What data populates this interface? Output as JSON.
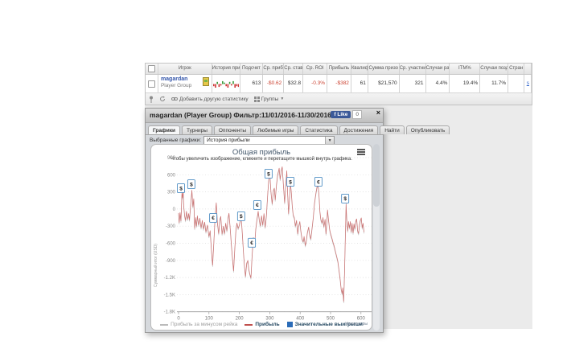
{
  "page": {
    "bg": "#ffffff",
    "content_bg": "#ebebeb"
  },
  "table": {
    "headers": [
      "",
      "Игрок",
      "История прибы",
      "Подсчет",
      "Ср. прибы",
      "Ср. ставк",
      "Ср. ROI",
      "Прибыль",
      "Квалиф",
      "Сумма призо",
      "Ср. участни",
      "Случаи ран",
      "ITM%",
      "Случаи позд",
      "Стран",
      ""
    ],
    "row": {
      "player": "magardan",
      "player_sub": "Player Group",
      "sparkline": [
        -3,
        -5,
        3,
        -4,
        -2,
        4,
        2,
        -3,
        -5,
        3,
        -2,
        4,
        -5,
        -3,
        -4
      ],
      "values": [
        {
          "v": "613"
        },
        {
          "v": "-$0.62",
          "neg": true
        },
        {
          "v": "$32.8"
        },
        {
          "v": "-0.3%",
          "neg": true
        },
        {
          "v": "-$382",
          "neg": true
        },
        {
          "v": "61"
        },
        {
          "v": "$21,570"
        },
        {
          "v": "321"
        },
        {
          "v": "4.4%"
        },
        {
          "v": "19.4%"
        },
        {
          "v": "11.7%"
        },
        {
          "v": ""
        },
        {
          "v": "s",
          "link": true
        }
      ]
    },
    "footer": {
      "add_stat": "Добавить другую статистику",
      "groups": "Группы"
    }
  },
  "widget": {
    "title": "magardan (Player Group) Фильтр:11/01/2016-11/30/2016",
    "fb": {
      "like": "Like",
      "count": "0",
      "logo": "f"
    },
    "close": "×",
    "tabs": [
      {
        "label": "Графики",
        "active": true
      },
      {
        "label": "Турниры",
        "active": false
      },
      {
        "label": "Оппоненты",
        "active": false
      },
      {
        "label": "Любимые игры",
        "active": false
      },
      {
        "label": "Статистика",
        "active": false
      },
      {
        "label": "Достижения",
        "active": false
      },
      {
        "label": "Найти",
        "active": false
      },
      {
        "label": "Опубликовать",
        "active": false
      }
    ],
    "selector_label": "Выбранные графики:",
    "selector_value": "История прибыли"
  },
  "chart_data": {
    "type": "line",
    "title": "Общая прибыль",
    "subtitle": "Чтобы увеличить изображение, кликните и перетащите мышкой внутрь графика.",
    "xlabel": "Номер игры",
    "ylabel": "Суммарный итог (USD)",
    "xlim": [
      0,
      620
    ],
    "ylim": [
      -1800,
      900
    ],
    "grid": "horizontal-dotted",
    "legend_position": "bottom",
    "yticks": [
      {
        "v": 900,
        "label": "900"
      },
      {
        "v": 600,
        "label": "600"
      },
      {
        "v": 300,
        "label": "300"
      },
      {
        "v": 0,
        "label": "0"
      },
      {
        "v": -300,
        "label": "-300"
      },
      {
        "v": -600,
        "label": "-600"
      },
      {
        "v": -900,
        "label": "-900"
      },
      {
        "v": -1200,
        "label": "-1.2K"
      },
      {
        "v": -1500,
        "label": "-1.5K"
      },
      {
        "v": -1800,
        "label": "-1.8K"
      }
    ],
    "xticks": [
      0,
      100,
      200,
      300,
      400,
      500,
      600
    ],
    "colors": {
      "profit_line": "#cc7070",
      "rake_line": "#c9c9c9",
      "marker_border": "#4f8fc4",
      "big_win_square": "#2b6cb8",
      "legend_red": "#c0504d",
      "grid": "#dcdcdc"
    },
    "legend": [
      "Прибыль за минусом рейка",
      "Прибыль",
      "Значительные выигрыши"
    ],
    "series": [
      {
        "name": "Прибыль за минусом рейка",
        "offset_from_profit": -25
      },
      {
        "name": "Прибыль",
        "points": [
          [
            0,
            -70
          ],
          [
            2,
            -240
          ],
          [
            5,
            -60
          ],
          [
            8,
            -210
          ],
          [
            11,
            280
          ],
          [
            13,
            200
          ],
          [
            15,
            320
          ],
          [
            17,
            60
          ],
          [
            20,
            -120
          ],
          [
            23,
            -200
          ],
          [
            26,
            -40
          ],
          [
            30,
            -180
          ],
          [
            33,
            -80
          ],
          [
            36,
            -190
          ],
          [
            40,
            90
          ],
          [
            44,
            330
          ],
          [
            47,
            40
          ],
          [
            50,
            180
          ],
          [
            53,
            -340
          ],
          [
            56,
            -150
          ],
          [
            59,
            -300
          ],
          [
            62,
            -120
          ],
          [
            66,
            -280
          ],
          [
            70,
            -160
          ],
          [
            74,
            -330
          ],
          [
            78,
            -200
          ],
          [
            82,
            -350
          ],
          [
            86,
            -230
          ],
          [
            90,
            -400
          ],
          [
            95,
            -280
          ],
          [
            100,
            -480
          ],
          [
            104,
            -380
          ],
          [
            108,
            -700
          ],
          [
            112,
            -985
          ],
          [
            116,
            -600
          ],
          [
            120,
            -150
          ],
          [
            124,
            110
          ],
          [
            128,
            -250
          ],
          [
            132,
            -430
          ],
          [
            136,
            -180
          ],
          [
            139,
            -130
          ],
          [
            143,
            -440
          ],
          [
            147,
            -300
          ],
          [
            151,
            -430
          ],
          [
            155,
            -250
          ],
          [
            159,
            -380
          ],
          [
            163,
            -150
          ],
          [
            166,
            -75
          ],
          [
            170,
            -350
          ],
          [
            174,
            -650
          ],
          [
            178,
            -900
          ],
          [
            181,
            -1085
          ],
          [
            185,
            -700
          ],
          [
            189,
            -350
          ],
          [
            192,
            -245
          ],
          [
            196,
            -340
          ],
          [
            200,
            -280
          ],
          [
            203,
            -200
          ],
          [
            206,
            -145
          ],
          [
            210,
            -450
          ],
          [
            214,
            -800
          ],
          [
            217,
            -1000
          ],
          [
            220,
            -1180
          ],
          [
            224,
            -950
          ],
          [
            228,
            -900
          ],
          [
            231,
            -1050
          ],
          [
            235,
            -1150
          ],
          [
            238,
            -1205
          ],
          [
            242,
            -800
          ],
          [
            246,
            -500
          ],
          [
            250,
            -650
          ],
          [
            254,
            -350
          ],
          [
            258,
            -180
          ],
          [
            262,
            -40
          ],
          [
            266,
            -200
          ],
          [
            269,
            -295
          ],
          [
            273,
            -120
          ],
          [
            277,
            -280
          ],
          [
            281,
            -80
          ],
          [
            285,
            -320
          ],
          [
            289,
            -120
          ],
          [
            293,
            250
          ],
          [
            297,
            550
          ],
          [
            300,
            635
          ],
          [
            304,
            300
          ],
          [
            308,
            90
          ],
          [
            312,
            330
          ],
          [
            315,
            365
          ],
          [
            318,
            160
          ],
          [
            322,
            420
          ],
          [
            326,
            600
          ],
          [
            331,
            715
          ],
          [
            334,
            520
          ],
          [
            338,
            680
          ],
          [
            341,
            740
          ],
          [
            345,
            420
          ],
          [
            349,
            110
          ],
          [
            352,
            400
          ],
          [
            356,
            670
          ],
          [
            359,
            250
          ],
          [
            362,
            -80
          ],
          [
            365,
            200
          ],
          [
            368,
            450
          ],
          [
            371,
            300
          ],
          [
            374,
            50
          ],
          [
            377,
            -100
          ],
          [
            381,
            -155
          ],
          [
            384,
            -300
          ],
          [
            388,
            -200
          ],
          [
            392,
            -435
          ],
          [
            395,
            -300
          ],
          [
            399,
            -220
          ],
          [
            402,
            -380
          ],
          [
            406,
            -520
          ],
          [
            410,
            -575
          ],
          [
            413,
            -480
          ],
          [
            417,
            -640
          ],
          [
            420,
            -560
          ],
          [
            424,
            -400
          ],
          [
            428,
            -315
          ],
          [
            431,
            -440
          ],
          [
            435,
            -525
          ],
          [
            439,
            -350
          ],
          [
            443,
            -150
          ],
          [
            447,
            100
          ],
          [
            451,
            250
          ],
          [
            455,
            380
          ],
          [
            459,
            420
          ],
          [
            462,
            250
          ],
          [
            465,
            -50
          ],
          [
            468,
            -180
          ],
          [
            472,
            -245
          ],
          [
            475,
            -150
          ],
          [
            478,
            -310
          ],
          [
            482,
            -180
          ],
          [
            485,
            -435
          ],
          [
            488,
            -200
          ],
          [
            490,
            -15
          ],
          [
            493,
            -180
          ],
          [
            497,
            -360
          ],
          [
            500,
            -430
          ],
          [
            504,
            -500
          ],
          [
            508,
            -580
          ],
          [
            512,
            -650
          ],
          [
            516,
            -740
          ],
          [
            520,
            -830
          ],
          [
            524,
            -920
          ],
          [
            528,
            -1080
          ],
          [
            532,
            -1250
          ],
          [
            535,
            -1400
          ],
          [
            538,
            -1480
          ],
          [
            540,
            -1380
          ],
          [
            543,
            -1620
          ],
          [
            546,
            -1100
          ],
          [
            549,
            -400
          ],
          [
            551,
            90
          ],
          [
            553,
            -150
          ],
          [
            556,
            -385
          ],
          [
            559,
            -220
          ],
          [
            562,
            -330
          ],
          [
            565,
            -220
          ],
          [
            568,
            -400
          ],
          [
            571,
            -250
          ],
          [
            574,
            -420
          ],
          [
            577,
            -260
          ],
          [
            580,
            -350
          ],
          [
            583,
            -200
          ],
          [
            586,
            -175
          ],
          [
            589,
            -380
          ],
          [
            592,
            -430
          ],
          [
            595,
            -280
          ],
          [
            598,
            -200
          ],
          [
            601,
            -155
          ],
          [
            604,
            -330
          ],
          [
            607,
            -250
          ],
          [
            610,
            -405
          ]
        ]
      }
    ],
    "markers": [
      {
        "game": 8,
        "usd": 365,
        "symbol": "$"
      },
      {
        "game": 42,
        "usd": 435,
        "symbol": "$"
      },
      {
        "game": 114,
        "usd": -155,
        "symbol": "€"
      },
      {
        "game": 206,
        "usd": -127,
        "symbol": "$"
      },
      {
        "game": 241,
        "usd": -591,
        "symbol": "€"
      },
      {
        "game": 259,
        "usd": 70,
        "symbol": "€"
      },
      {
        "game": 296,
        "usd": 619,
        "symbol": "$"
      },
      {
        "game": 368,
        "usd": 478,
        "symbol": "$"
      },
      {
        "game": 460,
        "usd": 478,
        "symbol": "€"
      },
      {
        "game": 548,
        "usd": 183,
        "symbol": "$"
      }
    ]
  }
}
